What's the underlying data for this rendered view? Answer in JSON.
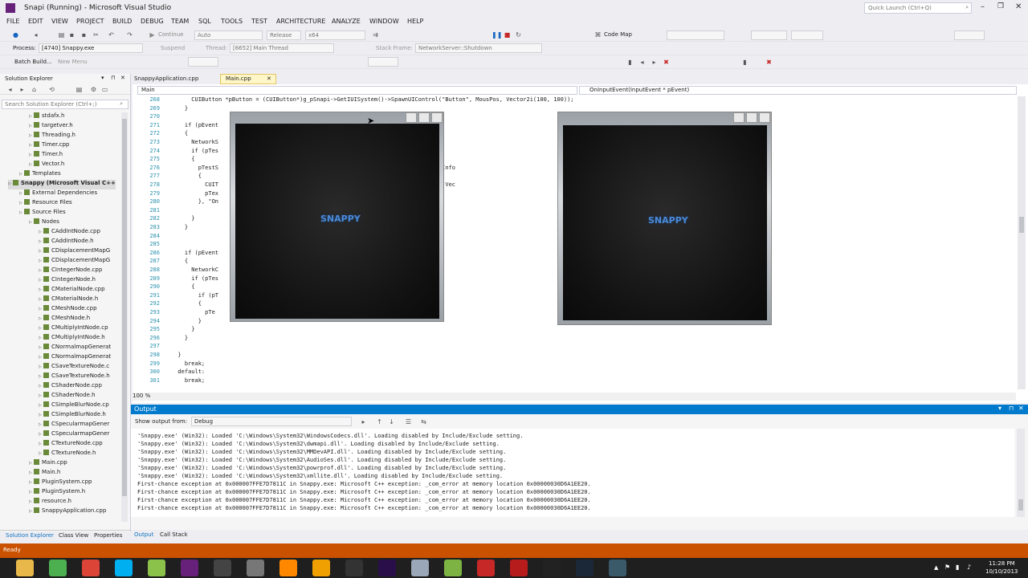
{
  "window": {
    "title": "Snapi (Running) - Microsoft Visual Studio",
    "quick_launch": "Quick Launch (Ctrl+Q)"
  },
  "menu": [
    "FILE",
    "EDIT",
    "VIEW",
    "PROJECT",
    "BUILD",
    "DEBUG",
    "TEAM",
    "SQL",
    "TOOLS",
    "TEST",
    "ARCHITECTURE",
    "ANALYZE",
    "WINDOW",
    "HELP"
  ],
  "toolbar": {
    "continue_label": "Continue",
    "auto_value": "Auto",
    "config_value": "Release",
    "platform_value": "x64",
    "code_map_label": "Code Map",
    "process_label": "Process:",
    "process_value": "[4740] Snappy.exe",
    "suspend_label": "Suspend",
    "thread_label": "Thread:",
    "thread_value": "[6652] Main Thread",
    "stack_label": "Stack Frame:",
    "stack_value": "NetworkServer::Shutdown",
    "batch_build_label": "Batch Build...",
    "new_menu_label": "New Menu"
  },
  "solution_explorer": {
    "title": "Solution Explorer",
    "search_placeholder": "Search Solution Explorer (Ctrl+;)",
    "items": [
      {
        "label": "stdafx.h",
        "level": 3
      },
      {
        "label": "targetver.h",
        "level": 3
      },
      {
        "label": "Threading.h",
        "level": 3
      },
      {
        "label": "Timer.cpp",
        "level": 3
      },
      {
        "label": "Timer.h",
        "level": 3
      },
      {
        "label": "Vector.h",
        "level": 3
      },
      {
        "label": "Templates",
        "level": 2
      },
      {
        "label": "Snappy (Microsoft Visual C++",
        "level": 1
      },
      {
        "label": "External Dependencies",
        "level": 2
      },
      {
        "label": "Resource Files",
        "level": 2
      },
      {
        "label": "Source Files",
        "level": 2
      },
      {
        "label": "Nodes",
        "level": 3
      },
      {
        "label": "CAddIntNode.cpp",
        "level": 4
      },
      {
        "label": "CAddIntNode.h",
        "level": 4
      },
      {
        "label": "CDisplacementMapG",
        "level": 4
      },
      {
        "label": "CDisplacementMapG",
        "level": 4
      },
      {
        "label": "CIntegerNode.cpp",
        "level": 4
      },
      {
        "label": "CIntegerNode.h",
        "level": 4
      },
      {
        "label": "CMaterialNode.cpp",
        "level": 4
      },
      {
        "label": "CMaterialNode.h",
        "level": 4
      },
      {
        "label": "CMeshNode.cpp",
        "level": 4
      },
      {
        "label": "CMeshNode.h",
        "level": 4
      },
      {
        "label": "CMultiplyIntNode.cp",
        "level": 4
      },
      {
        "label": "CMultiplyIntNode.h",
        "level": 4
      },
      {
        "label": "CNormalmapGenerat",
        "level": 4
      },
      {
        "label": "CNormalmapGenerat",
        "level": 4
      },
      {
        "label": "CSaveTextureNode.c",
        "level": 4
      },
      {
        "label": "CSaveTextureNode.h",
        "level": 4
      },
      {
        "label": "CShaderNode.cpp",
        "level": 4
      },
      {
        "label": "CShaderNode.h",
        "level": 4
      },
      {
        "label": "CSimpleBlurNode.cp",
        "level": 4
      },
      {
        "label": "CSimpleBlurNode.h",
        "level": 4
      },
      {
        "label": "CSpecularmapGener",
        "level": 4
      },
      {
        "label": "CSpecularmapGener",
        "level": 4
      },
      {
        "label": "CTextureNode.cpp",
        "level": 4
      },
      {
        "label": "CTextureNode.h",
        "level": 4
      },
      {
        "label": "Main.cpp",
        "level": 3
      },
      {
        "label": "Main.h",
        "level": 3
      },
      {
        "label": "PluginSystem.cpp",
        "level": 3
      },
      {
        "label": "PluginSystem.h",
        "level": 3
      },
      {
        "label": "resource.h",
        "level": 3
      },
      {
        "label": "SnappyApplication.cpp",
        "level": 3
      }
    ],
    "bottom_tabs": [
      "Solution Explorer",
      "Class View",
      "Properties"
    ]
  },
  "editor": {
    "tabs": [
      "SnappyApplication.cpp",
      "Main.cpp"
    ],
    "active_tab": "Main.cpp",
    "scope_left": "Main",
    "scope_right": "OnInputEvent(InputEvent * pEvent)",
    "zoom": "100 %",
    "lines": [
      {
        "n": "268",
        "t": "      CUIButton *pButton = (CUIButton*)g_pSnapi->GetIUISystem()->SpawnUIControl(\"Button\", MousPos, Vector2i(100, 100));"
      },
      {
        "n": "269",
        "t": "    }"
      },
      {
        "n": "270",
        "t": ""
      },
      {
        "n": "271",
        "t": "    if (pEvent                                        = EBS_RELEASED))"
      },
      {
        "n": "272",
        "t": "    {"
      },
      {
        "n": "273",
        "t": "      NetworkS                                        eServer(\"TestServer\", 444);"
      },
      {
        "n": "274",
        "t": "      if (pTes"
      },
      {
        "n": "275",
        "t": "      {"
      },
      {
        "n": "276",
        "t": "        pTestS                                        ieved_Event_SIG>([](SocketInfo"
      },
      {
        "n": "277",
        "t": "        {"
      },
      {
        "n": "278",
        "t": "          CUIT                                        >SpawnUIControl(\"Textbox\", Vec"
      },
      {
        "n": "279",
        "t": "          pTex"
      },
      {
        "n": "280",
        "t": "        }, \"On"
      },
      {
        "n": "281",
        "t": ""
      },
      {
        "n": "282",
        "t": "      }"
      },
      {
        "n": "283",
        "t": "    }"
      },
      {
        "n": "284",
        "t": ""
      },
      {
        "n": "285",
        "t": ""
      },
      {
        "n": "286",
        "t": "    if (pEvent                                        RELEASED))"
      },
      {
        "n": "287",
        "t": "    {"
      },
      {
        "n": "288",
        "t": "      NetworkC                                        eClient(\"TestClient\");"
      },
      {
        "n": "289",
        "t": "      if (pTes"
      },
      {
        "n": "290",
        "t": "      {"
      },
      {
        "n": "291",
        "t": "        if (pT"
      },
      {
        "n": "292",
        "t": "        {"
      },
      {
        "n": "293",
        "t": "          pTe                                         appy App :)!\");"
      },
      {
        "n": "294",
        "t": "        }"
      },
      {
        "n": "295",
        "t": "      }"
      },
      {
        "n": "296",
        "t": "    }"
      },
      {
        "n": "297",
        "t": ""
      },
      {
        "n": "298",
        "t": "  }"
      },
      {
        "n": "299",
        "t": "    break;"
      },
      {
        "n": "300",
        "t": "  default:"
      },
      {
        "n": "301",
        "t": "    break;"
      }
    ]
  },
  "app_windows": {
    "logo_left": "SNAPPY",
    "logo_right": "SNAPPY"
  },
  "output": {
    "title": "Output",
    "show_from_label": "Show output from:",
    "source_value": "Debug",
    "lines": [
      "'Snappy.exe' (Win32): Loaded 'C:\\Windows\\System32\\WindowsCodecs.dll'. Loading disabled by Include/Exclude setting.",
      "'Snappy.exe' (Win32): Loaded 'C:\\Windows\\System32\\dwmapi.dll'. Loading disabled by Include/Exclude setting.",
      "'Snappy.exe' (Win32): Loaded 'C:\\Windows\\System32\\MMDevAPI.dll'. Loading disabled by Include/Exclude setting.",
      "'Snappy.exe' (Win32): Loaded 'C:\\Windows\\System32\\AudioSes.dll'. Loading disabled by Include/Exclude setting.",
      "'Snappy.exe' (Win32): Loaded 'C:\\Windows\\System32\\powrprof.dll'. Loading disabled by Include/Exclude setting.",
      "'Snappy.exe' (Win32): Loaded 'C:\\Windows\\System32\\xmllite.dll'. Loading disabled by Include/Exclude setting.",
      "First-chance exception at 0x000007FFE7D7811C in Snappy.exe: Microsoft C++ exception: _com_error at memory location 0x00000030D6A1EE20.",
      "First-chance exception at 0x000007FFE7D7811C in Snappy.exe: Microsoft C++ exception: _com_error at memory location 0x00000030D6A1EE20.",
      "First-chance exception at 0x000007FFE7D7811C in Snappy.exe: Microsoft C++ exception: _com_error at memory location 0x00000030D6A1EE20.",
      "First-chance exception at 0x000007FFE7D7811C in Snappy.exe: Microsoft C++ exception: _com_error at memory location 0x00000030D6A1EE20."
    ],
    "bottom_tabs": [
      "Output",
      "Call Stack"
    ]
  },
  "status": {
    "text": "Ready"
  },
  "taskbar": {
    "time": "11:28 PM",
    "date": "10/10/2013",
    "apps": [
      {
        "name": "file-explorer-icon",
        "color": "#e8b84a"
      },
      {
        "name": "utility-icon",
        "color": "#4caf50"
      },
      {
        "name": "chrome-icon",
        "color": "#db4437"
      },
      {
        "name": "skype-icon",
        "color": "#00aff0"
      },
      {
        "name": "notepad-icon",
        "color": "#8bc34a"
      },
      {
        "name": "visual-studio-icon",
        "color": "#68217a"
      },
      {
        "name": "steam-like-icon",
        "color": "#444444"
      },
      {
        "name": "folder-icon",
        "color": "#777777"
      },
      {
        "name": "vlc-icon",
        "color": "#ff8800"
      },
      {
        "name": "headphones-icon",
        "color": "#f0a000"
      },
      {
        "name": "obs-icon",
        "color": "#333333"
      },
      {
        "name": "premiere-icon",
        "color": "#2a0e4a"
      },
      {
        "name": "ghost-icon",
        "color": "#9aa7b8"
      },
      {
        "name": "chat-icon",
        "color": "#7cb342"
      },
      {
        "name": "acrobat-icon",
        "color": "#c62828"
      },
      {
        "name": "filezilla-icon",
        "color": "#b71c1c"
      },
      {
        "name": "console-icon",
        "color": "#222222"
      },
      {
        "name": "steam-icon",
        "color": "#1b2838"
      },
      {
        "name": "app-window-icon",
        "color": "#3a5a6a"
      }
    ]
  }
}
